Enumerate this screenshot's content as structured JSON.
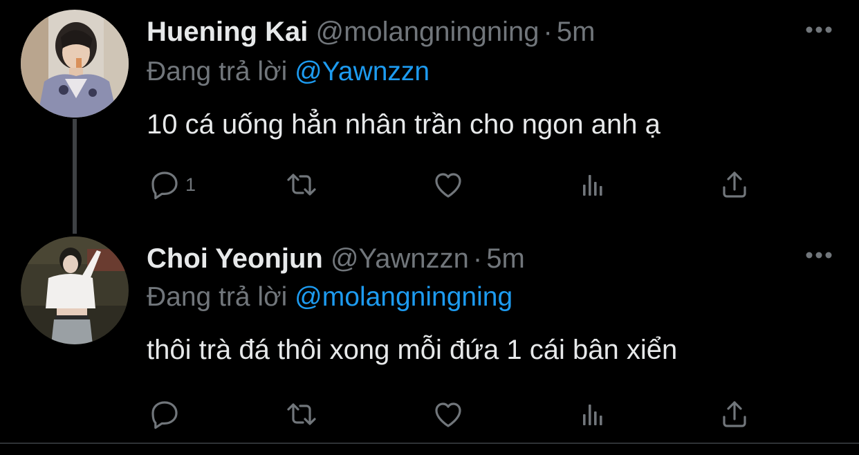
{
  "tweets": [
    {
      "name": "Huening Kai",
      "handle": "@molangningning",
      "separator": "·",
      "time": "5m",
      "reply_prefix": "Đang trả lời",
      "reply_to": "@Yawnzzn",
      "text": "10 cá uống hẳn nhân trần cho ngon anh ạ",
      "reply_count": "1"
    },
    {
      "name": "Choi Yeonjun",
      "handle": "@Yawnzzn",
      "separator": "·",
      "time": "5m",
      "reply_prefix": "Đang trả lời",
      "reply_to": "@molangningning",
      "text": "thôi trà đá thôi xong mỗi đứa 1 cái bân xiển",
      "reply_count": ""
    }
  ],
  "colors": {
    "background": "#000000",
    "primary_text": "#e7e9ea",
    "secondary_text": "#71767b",
    "mention": "#1d9bf0",
    "thread_line": "#3e4144"
  },
  "icons": [
    "reply-icon",
    "retweet-icon",
    "like-icon",
    "views-icon",
    "share-icon",
    "more-icon"
  ]
}
